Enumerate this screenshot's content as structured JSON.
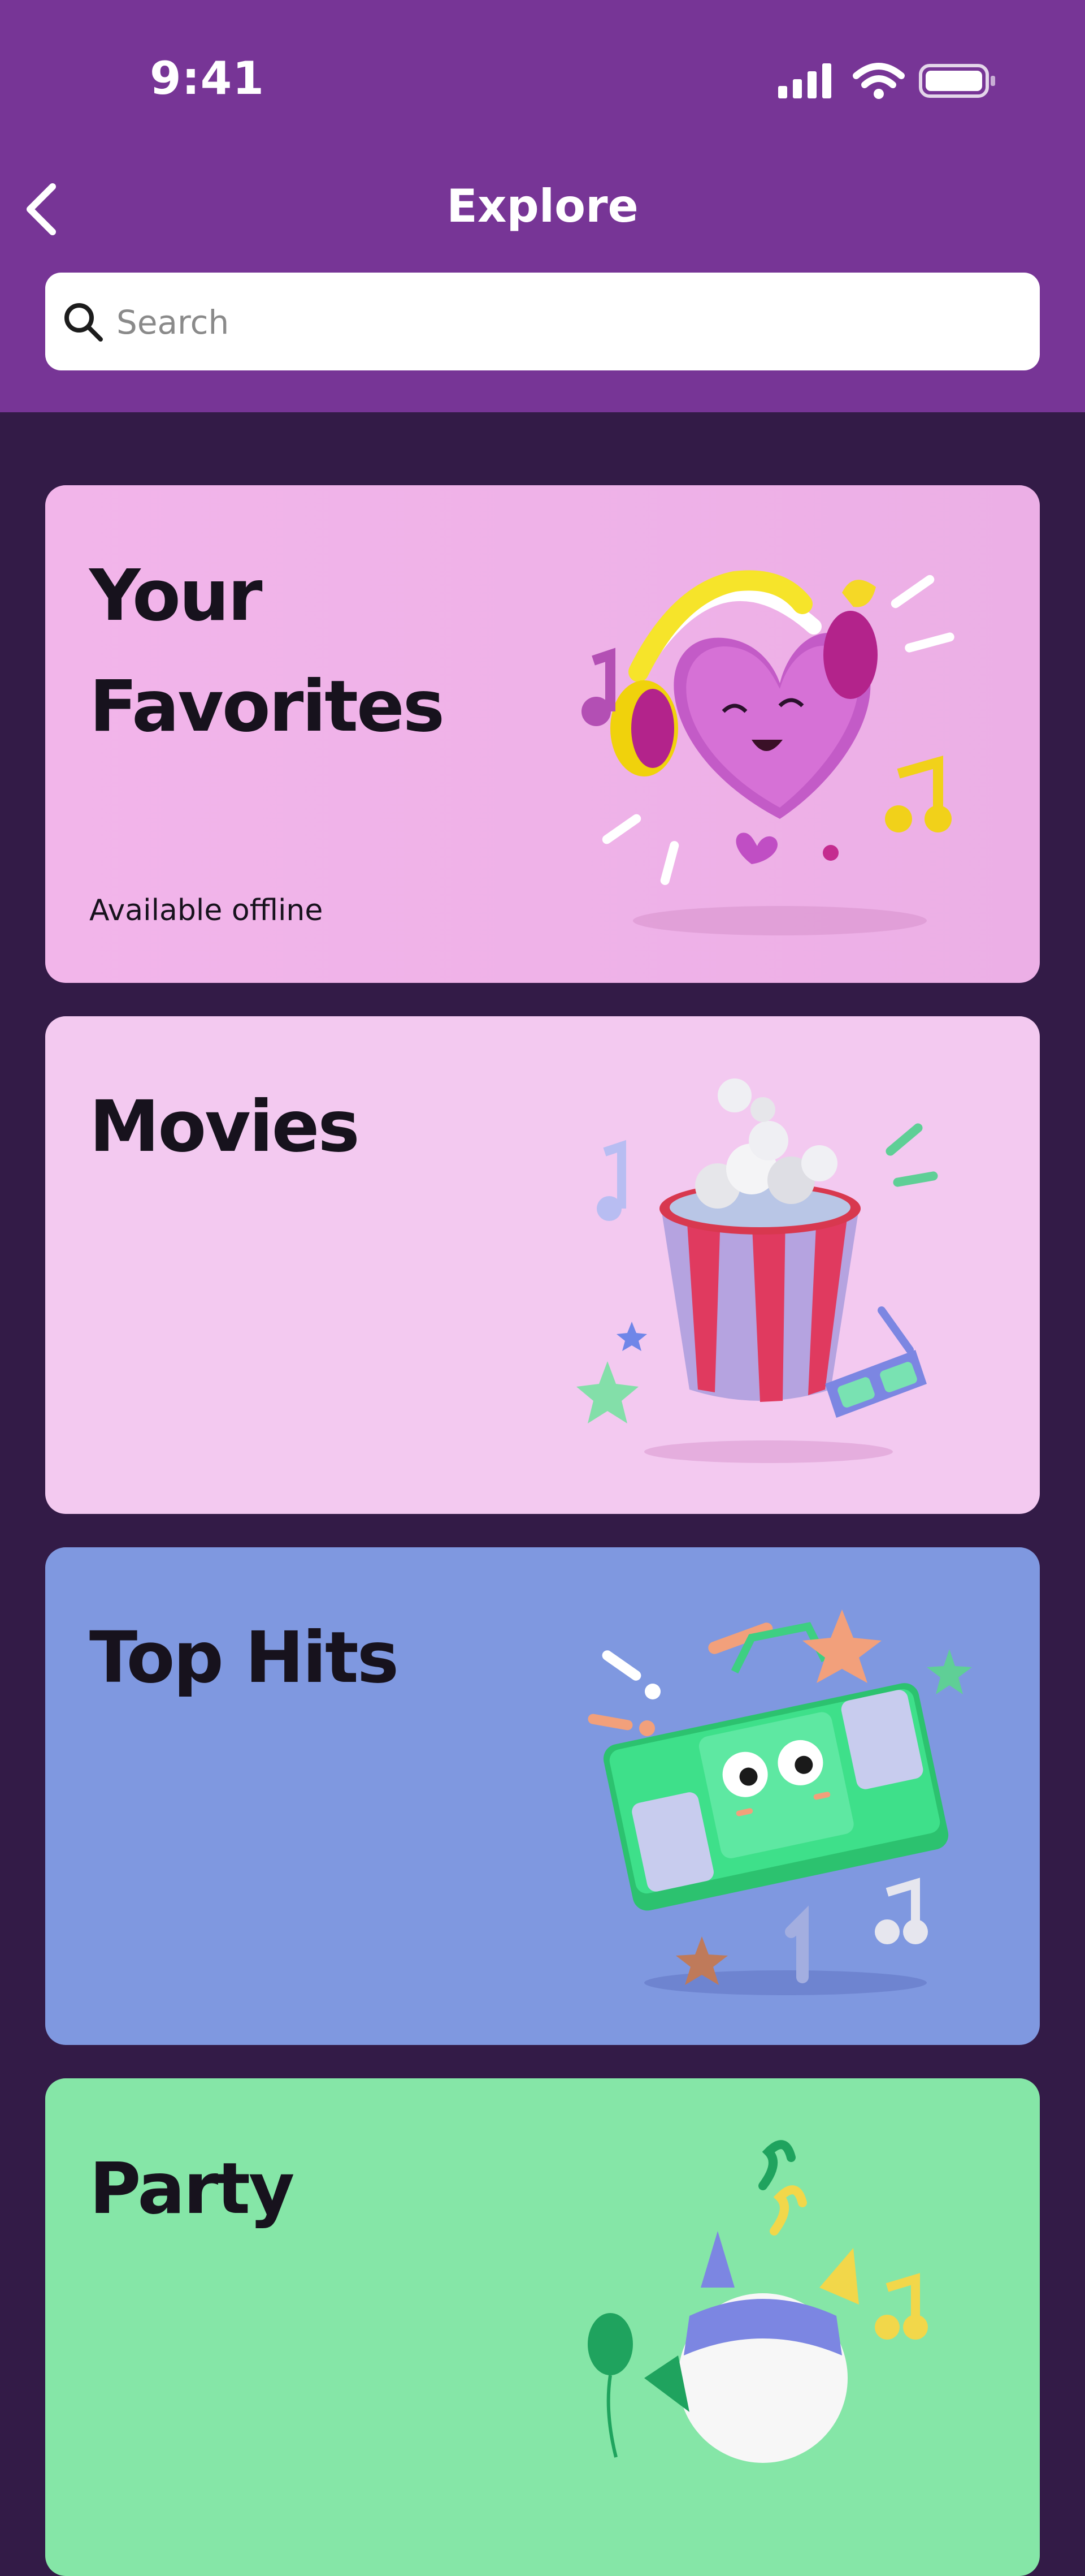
{
  "status_bar": {
    "time": "9:41"
  },
  "header": {
    "title": "Explore"
  },
  "search": {
    "placeholder": "Search",
    "value": ""
  },
  "cards": [
    {
      "title_line1": "Your",
      "title_line2": "Favorites",
      "subtitle": "Available offline",
      "color": "#efaee6",
      "illustration": "heart-headphones-illustration"
    },
    {
      "title": "Movies",
      "color": "#f3c9f0",
      "illustration": "popcorn-illustration"
    },
    {
      "title": "Top Hits",
      "color": "#7f98e0",
      "illustration": "boombox-illustration"
    },
    {
      "title": "Party",
      "color": "#85e6a7",
      "illustration": "party-ball-illustration"
    }
  ],
  "colors": {
    "header": "#773596",
    "background": "#331b47",
    "search_bg": "#ffffff"
  }
}
